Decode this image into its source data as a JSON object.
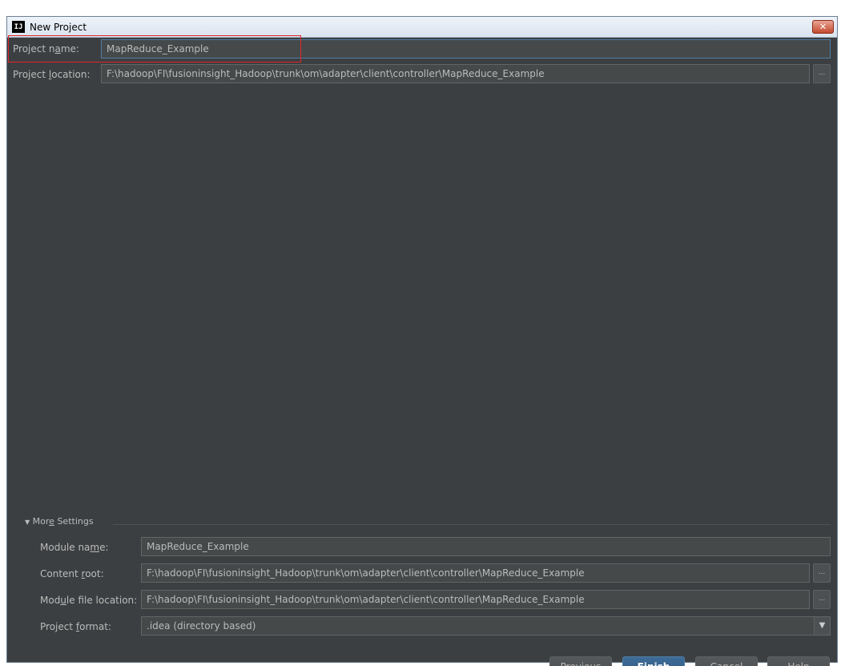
{
  "window": {
    "title": "New Project",
    "app_icon_text": "IJ",
    "close_symbol": "✕"
  },
  "project": {
    "name_label_pre": "Project n",
    "name_label_mn": "a",
    "name_label_post": "me:",
    "name_value": "MapReduce_Example",
    "location_label_pre": "Project ",
    "location_label_mn": "l",
    "location_label_post": "ocation:",
    "location_value": "F:\\hadoop\\FI\\fusioninsight_Hadoop\\trunk\\om\\adapter\\client\\controller\\MapReduce_Example",
    "browse_symbol": "..."
  },
  "more_settings": {
    "toggle_symbol": "▼",
    "label_pre": "Mor",
    "label_mn": "e",
    "label_post": " Settings",
    "module_name_label_pre": "Module na",
    "module_name_label_mn": "m",
    "module_name_label_post": "e:",
    "module_name_value": "MapReduce_Example",
    "content_root_label_pre": "Content ",
    "content_root_label_mn": "r",
    "content_root_label_post": "oot:",
    "content_root_value": "F:\\hadoop\\FI\\fusioninsight_Hadoop\\trunk\\om\\adapter\\client\\controller\\MapReduce_Example",
    "module_file_label_pre": "Mod",
    "module_file_label_mn": "u",
    "module_file_label_post": "le file location:",
    "module_file_value": "F:\\hadoop\\FI\\fusioninsight_Hadoop\\trunk\\om\\adapter\\client\\controller\\MapReduce_Example",
    "format_label_pre": "Project ",
    "format_label_mn": "f",
    "format_label_post": "ormat:",
    "format_value": ".idea (directory based)",
    "format_arrow": "▼"
  },
  "buttons": {
    "previous_mn": "P",
    "previous_rest": "revious",
    "finish_mn": "F",
    "finish_rest": "inish",
    "cancel": "Cancel",
    "help": "Help"
  },
  "colors": {
    "background": "#3c3f41",
    "field": "#45494a",
    "highlight": "#e0262b",
    "default_button": "#365b82"
  }
}
